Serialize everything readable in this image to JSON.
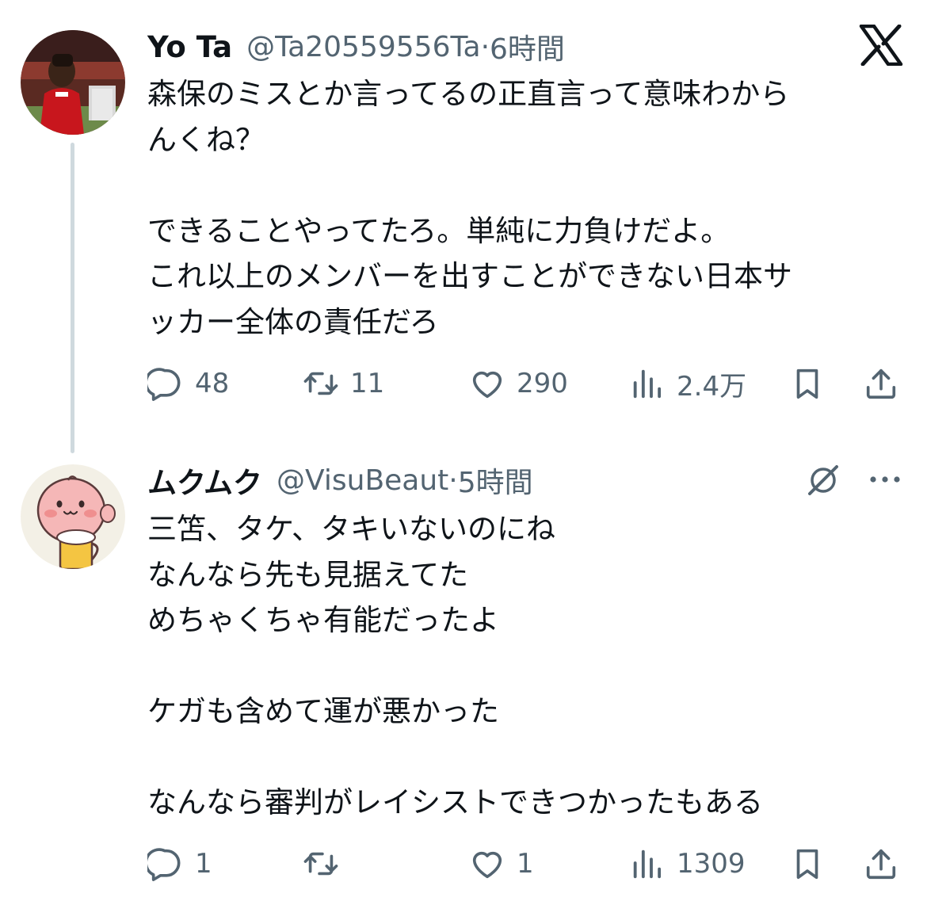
{
  "tweets": [
    {
      "display_name": "Yo Ta",
      "handle": "@Ta20559556Ta",
      "separator": "·",
      "time": "6時間",
      "avatar_icon": "profile-photo-soccer-player",
      "lines": [
        "森保のミスとか言ってるの正直言って意味わから",
        "んくね？",
        "",
        "できることやってたろ。単純に力負けだよ。",
        "これ以上のメンバーを出すことができない日本サ",
        "ッカー全体の責任だろ"
      ],
      "stats": {
        "replies": "48",
        "retweets": "11",
        "likes": "290",
        "views": "2.4万"
      }
    },
    {
      "display_name": "ムクムク",
      "handle": "@VisuBeaut",
      "separator": "·",
      "time": "5時間",
      "avatar_icon": "cartoon-peach-with-beer",
      "lines": [
        "三笘、タケ、タキいないのにね",
        "なんなら先も見据えてた",
        "めちゃくちゃ有能だったよ",
        "",
        "ケガも含めて運が悪かった",
        "",
        "なんなら審判がレイシストできつかったもある"
      ],
      "stats": {
        "replies": "1",
        "retweets": "",
        "likes": "1",
        "views": "1309"
      }
    }
  ],
  "icons": {
    "brand": "x-logo",
    "header_actions": [
      "grok-icon",
      "more-icon"
    ],
    "action_bar": [
      "reply-icon",
      "retweet-icon",
      "like-icon",
      "views-icon",
      "bookmark-icon",
      "share-icon"
    ]
  },
  "colors": {
    "text": "#0f1419",
    "secondary": "#536471",
    "thread_line": "#cfd9de",
    "background": "#ffffff"
  }
}
